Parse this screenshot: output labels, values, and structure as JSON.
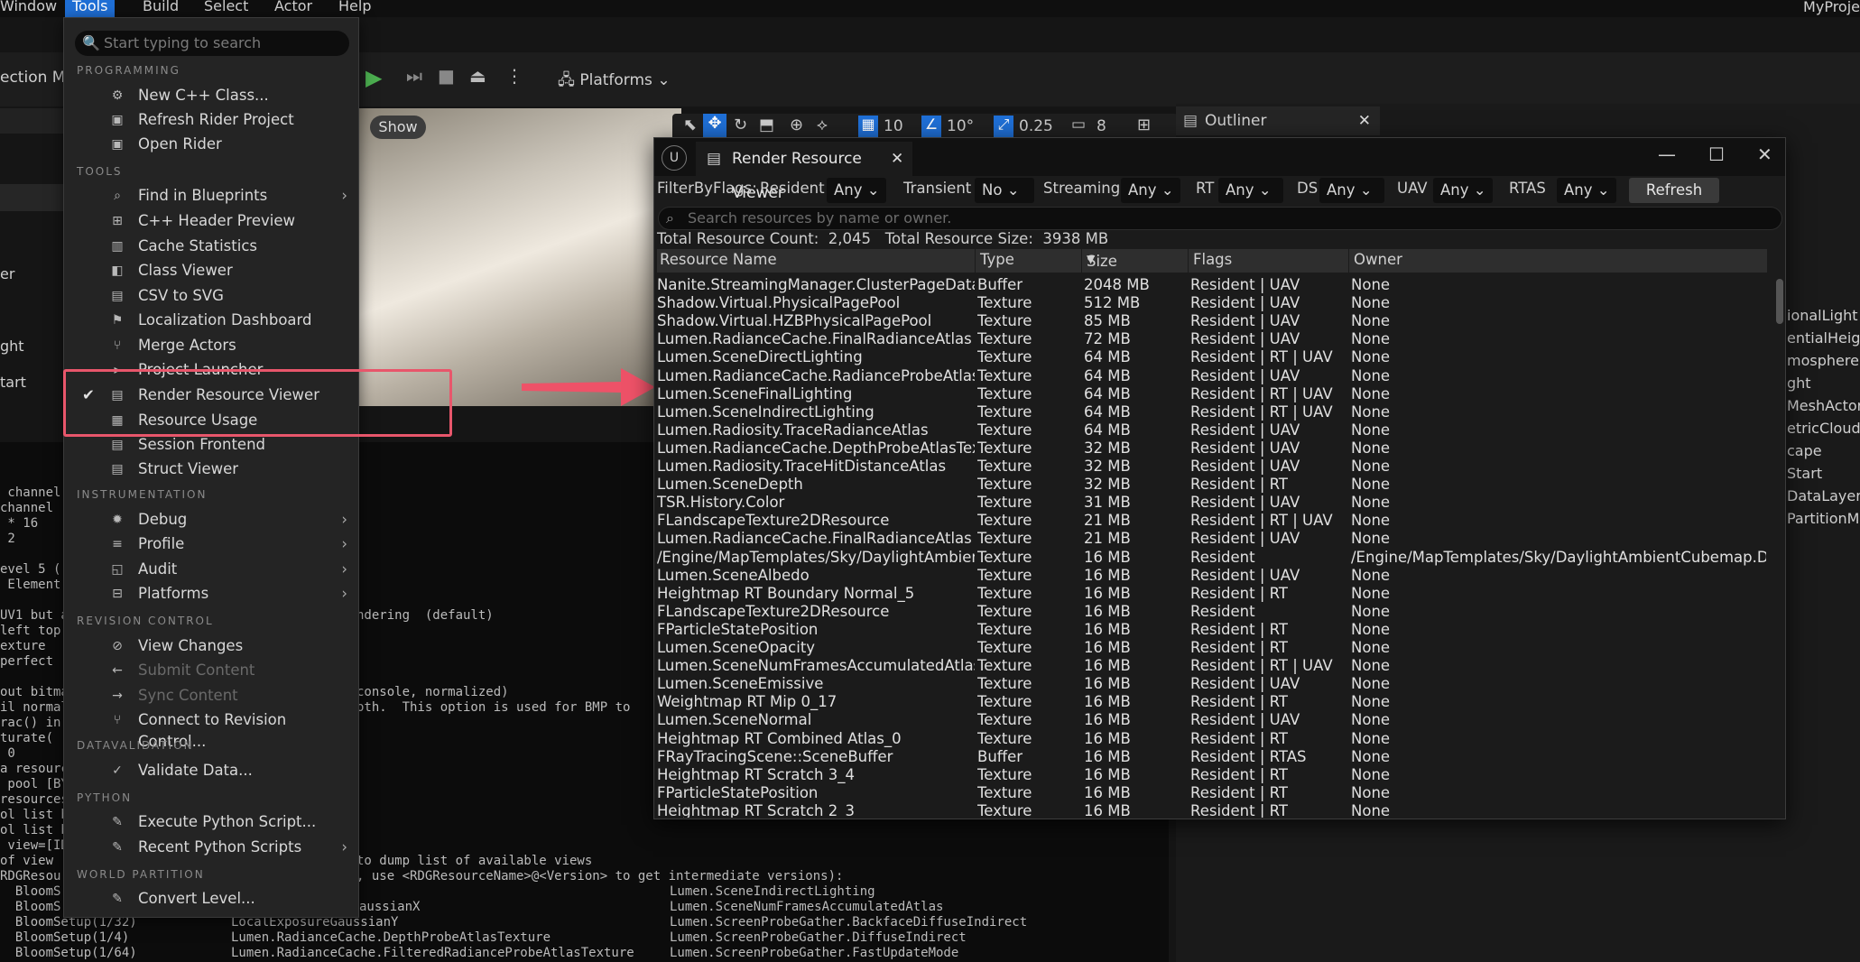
{
  "menubar": {
    "items": [
      "Window",
      "Tools",
      "Build",
      "Select",
      "Actor",
      "Help"
    ],
    "project": "MyProje"
  },
  "toolbar": {
    "left_text": "ection Mo",
    "platforms": "Platforms",
    "show": "Show",
    "grid": "10",
    "angle": "10°",
    "scale": "0.25",
    "cam": "8"
  },
  "outliner": {
    "title": "Outliner",
    "items": [
      "ionalLight",
      "entialHeig",
      "mosphere",
      "ght",
      "MeshActor",
      "etricCloud",
      "cape",
      "Start",
      "DataLayers",
      "PartitionM"
    ]
  },
  "left_strip": [
    "er",
    "ght",
    "tart"
  ],
  "menu": {
    "search_placeholder": "Start typing to search",
    "sections": {
      "programming": "PROGRAMMING",
      "tools": "TOOLS",
      "instrumentation": "INSTRUMENTATION",
      "revision": "REVISION CONTROL",
      "datavalidation": "DATAVALIDATION",
      "python": "PYTHON",
      "world": "WORLD PARTITION"
    },
    "items": {
      "new_cpp": "New C++ Class...",
      "refresh_rider": "Refresh Rider Project",
      "open_rider": "Open Rider",
      "find_bp": "Find in Blueprints",
      "cpp_header": "C++ Header Preview",
      "cache_stats": "Cache Statistics",
      "class_viewer": "Class Viewer",
      "csv_svg": "CSV to SVG",
      "loc_dash": "Localization Dashboard",
      "merge_actors": "Merge Actors",
      "project_launcher": "Project Launcher",
      "rrv": "Render Resource Viewer",
      "resource_usage": "Resource Usage",
      "session_frontend": "Session Frontend",
      "struct_viewer": "Struct Viewer",
      "debug": "Debug",
      "profile": "Profile",
      "audit": "Audit",
      "platforms": "Platforms",
      "view_changes": "View Changes",
      "submit": "Submit Content",
      "sync": "Sync Content",
      "connect_rc": "Connect to Revision Control...",
      "validate": "Validate Data...",
      "exec_py": "Execute Python Script...",
      "recent_py": "Recent Python Scripts",
      "convert_level": "Convert Level..."
    }
  },
  "log_lines": [
    " channel",
    "channel",
    " * 16",
    " 2",
    "evel 5 (",
    " Element",
    "UV1 but a",
    "left top",
    "exture",
    "perfect",
    "out bitma",
    "il normal",
    "rac() in",
    "turate(",
    " 0",
    "a resource",
    " pool [BY",
    "resources",
    "ol list b",
    "ol list b",
    " view=[ID",
    "of view"
  ],
  "log_mid": [
    "ndering  (default)",
    "console, normalized)",
    "oth.  This option is used for BMP to",
    "to dump list of available views",
    ", use <RDGResourceName>@<Version> to get intermediate versions):"
  ],
  "log_bottom": [
    [
      "RDGResou",
      "",
      ""
    ],
    [
      "  BloomS",
      "",
      "Lumen.SceneIndirectLighting"
    ],
    [
      "  BloomS",
      "aussianX",
      "Lumen.SceneNumFramesAccumulatedAtlas"
    ],
    [
      "  BloomSetup(1/32)",
      "LocalExposureGaussianY",
      "Lumen.ScreenProbeGather.BackfaceDiffuseIndirect"
    ],
    [
      "  BloomSetup(1/4)",
      "Lumen.RadianceCache.DepthProbeAtlasTexture",
      "Lumen.ScreenProbeGather.DiffuseIndirect"
    ],
    [
      "  BloomSetup(1/64)",
      "Lumen.RadianceCache.FilteredRadianceProbeAtlasTexture",
      "Lumen.ScreenProbeGather.FastUpdateMode"
    ]
  ],
  "rrv": {
    "title": "Render Resource Viewer",
    "filter_label": "FilterByFlags:",
    "filters": [
      {
        "label": "Resident",
        "value": "Any"
      },
      {
        "label": "Transient",
        "value": "No"
      },
      {
        "label": "Streaming",
        "value": "Any"
      },
      {
        "label": "RT",
        "value": "Any"
      },
      {
        "label": "DS",
        "value": "Any"
      },
      {
        "label": "UAV",
        "value": "Any"
      },
      {
        "label": "RTAS",
        "value": "Any"
      }
    ],
    "refresh": "Refresh",
    "search_placeholder": "Search resources by name or owner.",
    "total_count_label": "Total Resource Count:",
    "total_count": "2,045",
    "total_size_label": "Total Resource Size:",
    "total_size": "3938 MB",
    "columns": [
      "Resource Name",
      "Type",
      "Size",
      "Flags",
      "Owner"
    ],
    "rows": [
      [
        "Nanite.StreamingManager.ClusterPageData",
        "Buffer",
        "2048 MB",
        "Resident | UAV",
        "None"
      ],
      [
        "Shadow.Virtual.PhysicalPagePool",
        "Texture",
        "512 MB",
        "Resident | UAV",
        "None"
      ],
      [
        "Shadow.Virtual.HZBPhysicalPagePool",
        "Texture",
        "85 MB",
        "Resident | UAV",
        "None"
      ],
      [
        "Lumen.RadianceCache.FinalRadianceAtlas",
        "Texture",
        "72 MB",
        "Resident | UAV",
        "None"
      ],
      [
        "Lumen.SceneDirectLighting",
        "Texture",
        "64 MB",
        "Resident | RT | UAV",
        "None"
      ],
      [
        "Lumen.RadianceCache.RadianceProbeAtlasTe",
        "Texture",
        "64 MB",
        "Resident | UAV",
        "None"
      ],
      [
        "Lumen.SceneFinalLighting",
        "Texture",
        "64 MB",
        "Resident | RT | UAV",
        "None"
      ],
      [
        "Lumen.SceneIndirectLighting",
        "Texture",
        "64 MB",
        "Resident | RT | UAV",
        "None"
      ],
      [
        "Lumen.Radiosity.TraceRadianceAtlas",
        "Texture",
        "64 MB",
        "Resident | UAV",
        "None"
      ],
      [
        "Lumen.RadianceCache.DepthProbeAtlasTextu",
        "Texture",
        "32 MB",
        "Resident | UAV",
        "None"
      ],
      [
        "Lumen.Radiosity.TraceHitDistanceAtlas",
        "Texture",
        "32 MB",
        "Resident | UAV",
        "None"
      ],
      [
        "Lumen.SceneDepth",
        "Texture",
        "32 MB",
        "Resident | RT",
        "None"
      ],
      [
        "TSR.History.Color",
        "Texture",
        "31 MB",
        "Resident | UAV",
        "None"
      ],
      [
        "FLandscapeTexture2DResource",
        "Texture",
        "21 MB",
        "Resident | RT | UAV",
        "None"
      ],
      [
        "Lumen.RadianceCache.FinalRadianceAtlas",
        "Texture",
        "21 MB",
        "Resident | UAV",
        "None"
      ],
      [
        "/Engine/MapTemplates/Sky/DaylightAmbient",
        "Texture",
        "16 MB",
        "Resident",
        "/Engine/MapTemplates/Sky/DaylightAmbientCubemap.Dayli"
      ],
      [
        "Lumen.SceneAlbedo",
        "Texture",
        "16 MB",
        "Resident | UAV",
        "None"
      ],
      [
        "Heightmap RT Boundary Normal_5",
        "Texture",
        "16 MB",
        "Resident | RT",
        "None"
      ],
      [
        "FLandscapeTexture2DResource",
        "Texture",
        "16 MB",
        "Resident",
        "None"
      ],
      [
        "FParticleStatePosition",
        "Texture",
        "16 MB",
        "Resident | RT",
        "None"
      ],
      [
        "Lumen.SceneOpacity",
        "Texture",
        "16 MB",
        "Resident | RT",
        "None"
      ],
      [
        "Lumen.SceneNumFramesAccumulatedAtlas",
        "Texture",
        "16 MB",
        "Resident | RT | UAV",
        "None"
      ],
      [
        "Lumen.SceneEmissive",
        "Texture",
        "16 MB",
        "Resident | UAV",
        "None"
      ],
      [
        "Weightmap RT Mip 0_17",
        "Texture",
        "16 MB",
        "Resident | RT",
        "None"
      ],
      [
        "Lumen.SceneNormal",
        "Texture",
        "16 MB",
        "Resident | UAV",
        "None"
      ],
      [
        "Heightmap RT Combined Atlas_0",
        "Texture",
        "16 MB",
        "Resident | RT",
        "None"
      ],
      [
        "FRayTracingScene::SceneBuffer",
        "Buffer",
        "16 MB",
        "Resident | RTAS",
        "None"
      ],
      [
        "Heightmap RT Scratch 3_4",
        "Texture",
        "16 MB",
        "Resident | RT",
        "None"
      ],
      [
        "FParticleStatePosition",
        "Texture",
        "16 MB",
        "Resident | RT",
        "None"
      ],
      [
        "Heightmap RT Scratch 2_3",
        "Texture",
        "16 MB",
        "Resident | RT",
        "None"
      ]
    ]
  }
}
